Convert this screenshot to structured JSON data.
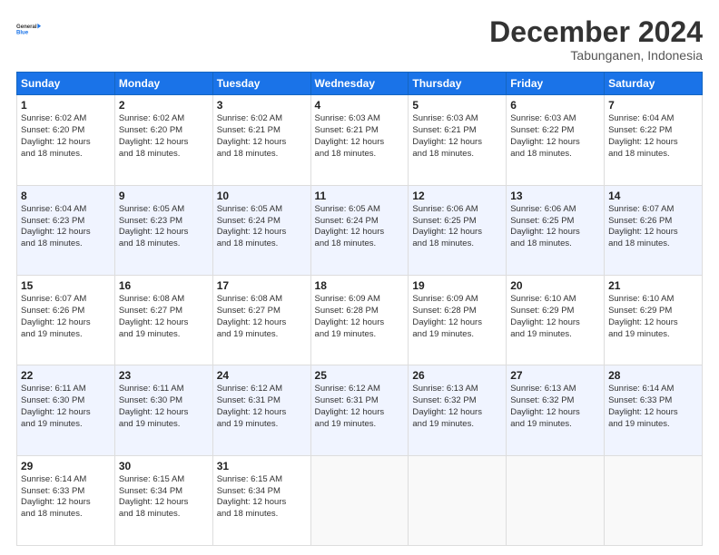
{
  "header": {
    "logo_line1": "General",
    "logo_line2": "Blue",
    "month": "December 2024",
    "location": "Tabunganen, Indonesia"
  },
  "days_of_week": [
    "Sunday",
    "Monday",
    "Tuesday",
    "Wednesday",
    "Thursday",
    "Friday",
    "Saturday"
  ],
  "weeks": [
    [
      {
        "day": "1",
        "lines": [
          "Sunrise: 6:02 AM",
          "Sunset: 6:20 PM",
          "Daylight: 12 hours",
          "and 18 minutes."
        ]
      },
      {
        "day": "2",
        "lines": [
          "Sunrise: 6:02 AM",
          "Sunset: 6:20 PM",
          "Daylight: 12 hours",
          "and 18 minutes."
        ]
      },
      {
        "day": "3",
        "lines": [
          "Sunrise: 6:02 AM",
          "Sunset: 6:21 PM",
          "Daylight: 12 hours",
          "and 18 minutes."
        ]
      },
      {
        "day": "4",
        "lines": [
          "Sunrise: 6:03 AM",
          "Sunset: 6:21 PM",
          "Daylight: 12 hours",
          "and 18 minutes."
        ]
      },
      {
        "day": "5",
        "lines": [
          "Sunrise: 6:03 AM",
          "Sunset: 6:21 PM",
          "Daylight: 12 hours",
          "and 18 minutes."
        ]
      },
      {
        "day": "6",
        "lines": [
          "Sunrise: 6:03 AM",
          "Sunset: 6:22 PM",
          "Daylight: 12 hours",
          "and 18 minutes."
        ]
      },
      {
        "day": "7",
        "lines": [
          "Sunrise: 6:04 AM",
          "Sunset: 6:22 PM",
          "Daylight: 12 hours",
          "and 18 minutes."
        ]
      }
    ],
    [
      {
        "day": "8",
        "lines": [
          "Sunrise: 6:04 AM",
          "Sunset: 6:23 PM",
          "Daylight: 12 hours",
          "and 18 minutes."
        ]
      },
      {
        "day": "9",
        "lines": [
          "Sunrise: 6:05 AM",
          "Sunset: 6:23 PM",
          "Daylight: 12 hours",
          "and 18 minutes."
        ]
      },
      {
        "day": "10",
        "lines": [
          "Sunrise: 6:05 AM",
          "Sunset: 6:24 PM",
          "Daylight: 12 hours",
          "and 18 minutes."
        ]
      },
      {
        "day": "11",
        "lines": [
          "Sunrise: 6:05 AM",
          "Sunset: 6:24 PM",
          "Daylight: 12 hours",
          "and 18 minutes."
        ]
      },
      {
        "day": "12",
        "lines": [
          "Sunrise: 6:06 AM",
          "Sunset: 6:25 PM",
          "Daylight: 12 hours",
          "and 18 minutes."
        ]
      },
      {
        "day": "13",
        "lines": [
          "Sunrise: 6:06 AM",
          "Sunset: 6:25 PM",
          "Daylight: 12 hours",
          "and 18 minutes."
        ]
      },
      {
        "day": "14",
        "lines": [
          "Sunrise: 6:07 AM",
          "Sunset: 6:26 PM",
          "Daylight: 12 hours",
          "and 18 minutes."
        ]
      }
    ],
    [
      {
        "day": "15",
        "lines": [
          "Sunrise: 6:07 AM",
          "Sunset: 6:26 PM",
          "Daylight: 12 hours",
          "and 19 minutes."
        ]
      },
      {
        "day": "16",
        "lines": [
          "Sunrise: 6:08 AM",
          "Sunset: 6:27 PM",
          "Daylight: 12 hours",
          "and 19 minutes."
        ]
      },
      {
        "day": "17",
        "lines": [
          "Sunrise: 6:08 AM",
          "Sunset: 6:27 PM",
          "Daylight: 12 hours",
          "and 19 minutes."
        ]
      },
      {
        "day": "18",
        "lines": [
          "Sunrise: 6:09 AM",
          "Sunset: 6:28 PM",
          "Daylight: 12 hours",
          "and 19 minutes."
        ]
      },
      {
        "day": "19",
        "lines": [
          "Sunrise: 6:09 AM",
          "Sunset: 6:28 PM",
          "Daylight: 12 hours",
          "and 19 minutes."
        ]
      },
      {
        "day": "20",
        "lines": [
          "Sunrise: 6:10 AM",
          "Sunset: 6:29 PM",
          "Daylight: 12 hours",
          "and 19 minutes."
        ]
      },
      {
        "day": "21",
        "lines": [
          "Sunrise: 6:10 AM",
          "Sunset: 6:29 PM",
          "Daylight: 12 hours",
          "and 19 minutes."
        ]
      }
    ],
    [
      {
        "day": "22",
        "lines": [
          "Sunrise: 6:11 AM",
          "Sunset: 6:30 PM",
          "Daylight: 12 hours",
          "and 19 minutes."
        ]
      },
      {
        "day": "23",
        "lines": [
          "Sunrise: 6:11 AM",
          "Sunset: 6:30 PM",
          "Daylight: 12 hours",
          "and 19 minutes."
        ]
      },
      {
        "day": "24",
        "lines": [
          "Sunrise: 6:12 AM",
          "Sunset: 6:31 PM",
          "Daylight: 12 hours",
          "and 19 minutes."
        ]
      },
      {
        "day": "25",
        "lines": [
          "Sunrise: 6:12 AM",
          "Sunset: 6:31 PM",
          "Daylight: 12 hours",
          "and 19 minutes."
        ]
      },
      {
        "day": "26",
        "lines": [
          "Sunrise: 6:13 AM",
          "Sunset: 6:32 PM",
          "Daylight: 12 hours",
          "and 19 minutes."
        ]
      },
      {
        "day": "27",
        "lines": [
          "Sunrise: 6:13 AM",
          "Sunset: 6:32 PM",
          "Daylight: 12 hours",
          "and 19 minutes."
        ]
      },
      {
        "day": "28",
        "lines": [
          "Sunrise: 6:14 AM",
          "Sunset: 6:33 PM",
          "Daylight: 12 hours",
          "and 19 minutes."
        ]
      }
    ],
    [
      {
        "day": "29",
        "lines": [
          "Sunrise: 6:14 AM",
          "Sunset: 6:33 PM",
          "Daylight: 12 hours",
          "and 18 minutes."
        ]
      },
      {
        "day": "30",
        "lines": [
          "Sunrise: 6:15 AM",
          "Sunset: 6:34 PM",
          "Daylight: 12 hours",
          "and 18 minutes."
        ]
      },
      {
        "day": "31",
        "lines": [
          "Sunrise: 6:15 AM",
          "Sunset: 6:34 PM",
          "Daylight: 12 hours",
          "and 18 minutes."
        ]
      },
      null,
      null,
      null,
      null
    ]
  ]
}
